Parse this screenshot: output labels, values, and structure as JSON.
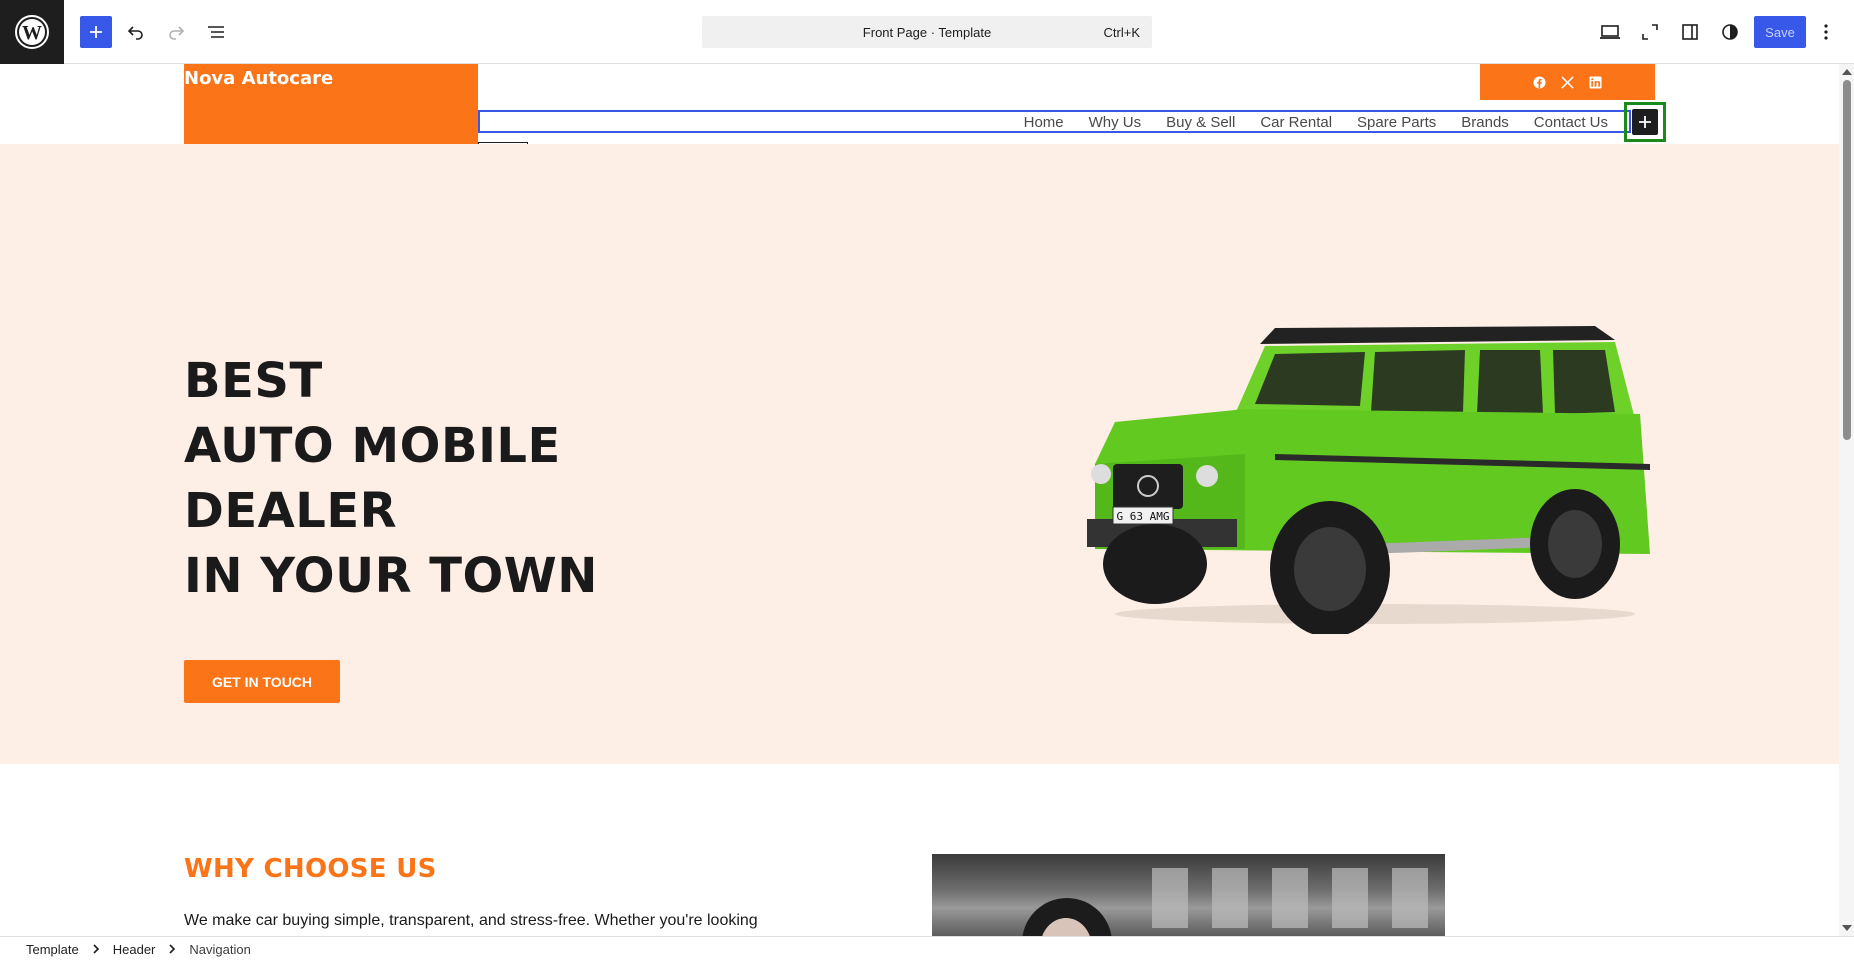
{
  "toolbar": {
    "command_bar": "Front Page · Template",
    "shortcut": "Ctrl+K",
    "save_label": "Save"
  },
  "header": {
    "site_title": "Nova Autocare",
    "nav_items": [
      "Home",
      "Why Us",
      "Buy & Sell",
      "Car Rental",
      "Spare Parts",
      "Brands",
      "Contact Us"
    ],
    "social_icons": [
      "facebook-icon",
      "x-icon",
      "linkedin-icon"
    ]
  },
  "hero": {
    "heading_lines": [
      "BEST",
      "AUTO MOBILE",
      "DEALER",
      "IN YOUR TOWN"
    ],
    "cta_label": "GET IN TOUCH",
    "plate": "G 63 AMG"
  },
  "why": {
    "title": "WHY CHOOSE US",
    "text": "We make car buying simple, transparent, and stress-free. Whether you're looking"
  },
  "breadcrumb": {
    "items": [
      "Template",
      "Header",
      "Navigation"
    ]
  },
  "colors": {
    "accent": "#fc7418",
    "hero_bg": "#fdeee6",
    "wp_blue": "#3858e9",
    "selection_green": "#1a8a1a"
  }
}
